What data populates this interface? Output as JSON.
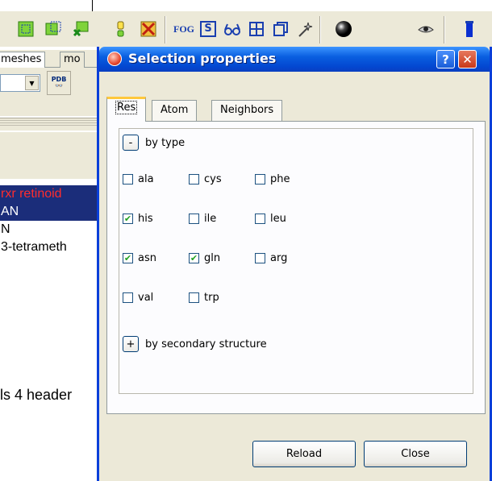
{
  "left_panel": {
    "tabs": [
      "meshes",
      "mo"
    ],
    "pdb_label": "PDB",
    "list": [
      "rxr retinoid",
      "AN",
      "N",
      "3-tetrameth"
    ],
    "header_text": "ls 4 header"
  },
  "toolbar": {
    "fog_label": "FOG",
    "s_label": "S"
  },
  "dialog": {
    "title": "Selection properties",
    "help_label": "?",
    "close_x": "✕",
    "tabs": [
      "Res",
      "Atom",
      "Neighbors"
    ],
    "by_type": {
      "toggle": "-",
      "label": "by type"
    },
    "residues": [
      {
        "label": "ala",
        "checked": false
      },
      {
        "label": "cys",
        "checked": false
      },
      {
        "label": "phe",
        "checked": false
      },
      {
        "label": "his",
        "checked": true
      },
      {
        "label": "ile",
        "checked": false
      },
      {
        "label": "leu",
        "checked": false
      },
      {
        "label": "asn",
        "checked": true
      },
      {
        "label": "gln",
        "checked": true
      },
      {
        "label": "arg",
        "checked": false
      },
      {
        "label": "val",
        "checked": false
      },
      {
        "label": "trp",
        "checked": false
      }
    ],
    "by_secondary": {
      "toggle": "+",
      "label": "by secondary structure"
    },
    "buttons": {
      "reload": "Reload",
      "close": "Close"
    }
  }
}
